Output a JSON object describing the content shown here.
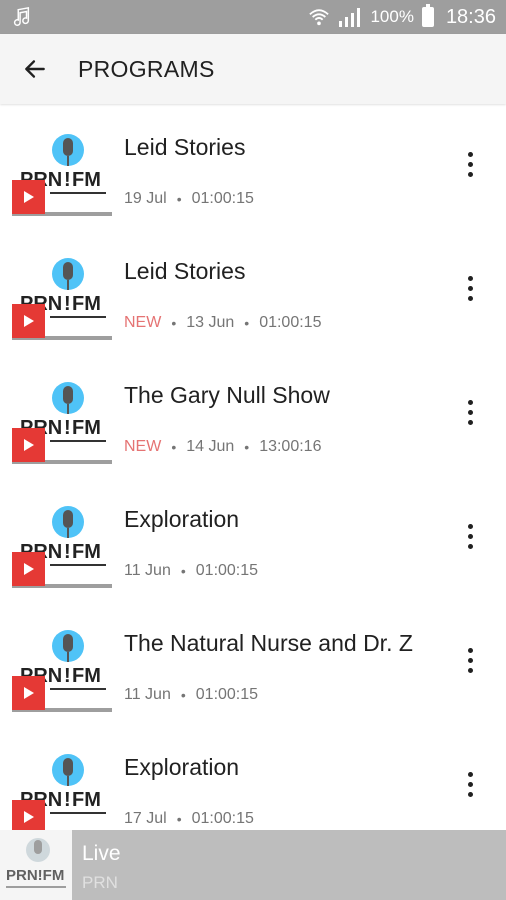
{
  "status_bar": {
    "battery": "100%",
    "time": "18:36",
    "icons": [
      "music-note-icon",
      "wifi-icon",
      "signal-icon",
      "battery-icon"
    ]
  },
  "app_bar": {
    "title": "PROGRAMS",
    "back_icon": "arrow-left-icon"
  },
  "programs": [
    {
      "title": "Leid Stories",
      "badge": "",
      "date": "19 Jul",
      "duration": "01:00:15"
    },
    {
      "title": "Leid Stories",
      "badge": "NEW",
      "date": "13 Jun",
      "duration": "01:00:15"
    },
    {
      "title": "The Gary Null Show",
      "badge": "NEW",
      "date": "14 Jun",
      "duration": "13:00:16"
    },
    {
      "title": "Exploration",
      "badge": "",
      "date": "11 Jun",
      "duration": "01:00:15"
    },
    {
      "title": "The Natural Nurse and Dr. Z",
      "badge": "",
      "date": "11 Jun",
      "duration": "01:00:15"
    },
    {
      "title": "Exploration",
      "badge": "",
      "date": "17 Jul",
      "duration": "01:00:15"
    }
  ],
  "mini_player": {
    "title": "Live",
    "subtitle": "PRN"
  },
  "colors": {
    "status_bar": "#9e9e9e",
    "app_bar": "#f5f5f5",
    "play_badge": "#e53935",
    "new_badge": "#e57373",
    "mini_player": "#bdbdbd"
  }
}
